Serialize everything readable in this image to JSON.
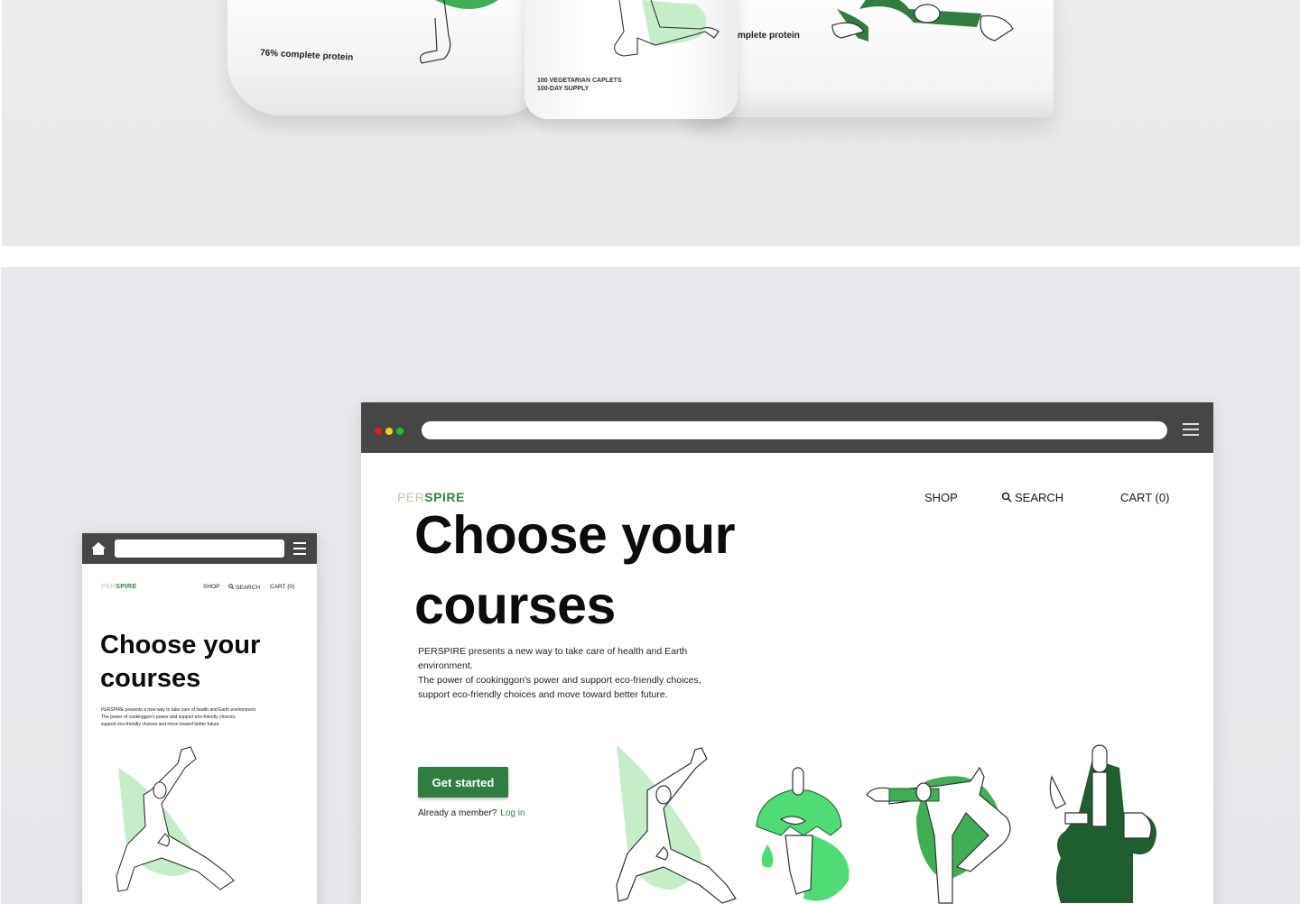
{
  "packaging": {
    "pouch_label": "76% complete protein",
    "jar_line1": "100 VEGETARIAN CAPLETS",
    "jar_line2": "100-DAY SUPPLY",
    "bag_label": "mplete protein"
  },
  "desktop": {
    "logo_part1": "PER",
    "logo_part2": "SPIRE",
    "nav": {
      "shop": "SHOP",
      "search": "SEARCH",
      "cart": "CART (0)"
    },
    "hero_line1": "Choose your",
    "hero_line2": "courses",
    "description_line1": "PERSPIRE presents a new way to take care of health and Earth environment.",
    "description_line2": "The power of cookinggon's power and support eco-friendly choices,",
    "description_line3": "support eco-friendly choices and move toward better future.",
    "cta_label": "Get started",
    "member_prompt": "Already a member?",
    "login_label": "Log in"
  },
  "mobile": {
    "logo_part1": "PER",
    "logo_part2": "SPIRE",
    "nav": {
      "shop": "SHOP",
      "search": "SEARCH",
      "cart": "CART (0)"
    },
    "hero_line1": "Choose your",
    "hero_line2": "courses",
    "description_line1": "PERSPIRE presents a new way to take care of health and Earth environment.",
    "description_line2": "The power of cookinggon's power and support eco-friendly choices,",
    "description_line3": "support eco-friendly choices and move toward better future."
  },
  "colors": {
    "brand_green": "#2f7d3f",
    "light_green": "#c5edc8",
    "bright_green": "#4fdc74",
    "dark_green": "#1f5e2e",
    "browser_chrome": "#464646"
  },
  "icons": [
    "window-close-dot",
    "window-minimize-dot",
    "window-maximize-dot",
    "hamburger-menu-icon",
    "search-icon",
    "home-icon"
  ]
}
